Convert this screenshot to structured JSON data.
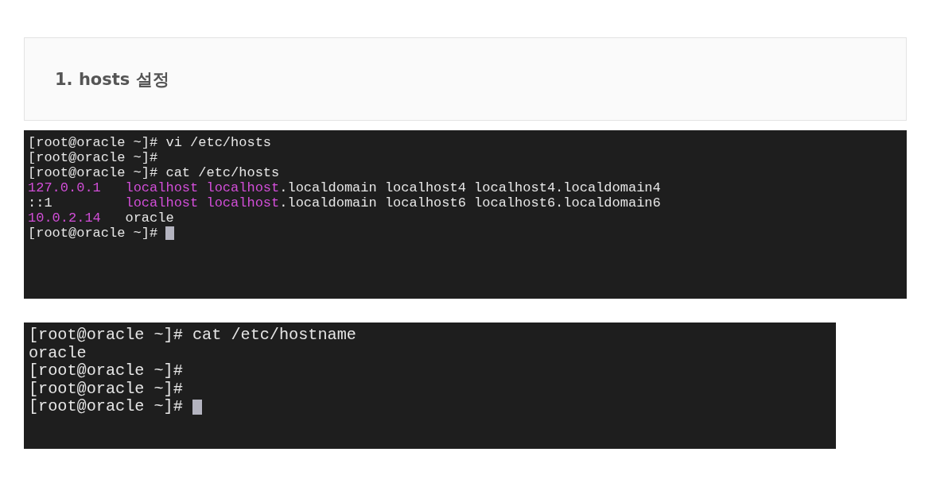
{
  "heading": "1. hosts 설정",
  "terminals": [
    {
      "lines": [
        {
          "segments": [
            {
              "text": "[root@oracle ~]# vi /etc/hosts",
              "kind": "plain"
            }
          ],
          "cursor": false
        },
        {
          "segments": [
            {
              "text": "[root@oracle ~]#",
              "kind": "plain"
            }
          ],
          "cursor": false
        },
        {
          "segments": [
            {
              "text": "[root@oracle ~]# cat /etc/hosts",
              "kind": "plain"
            }
          ],
          "cursor": false
        },
        {
          "segments": [
            {
              "text": "127.0.0.1",
              "kind": "magenta"
            },
            {
              "text": "   localhost localhost",
              "kind": "magenta"
            },
            {
              "text": ".localdomain localhost4 localhost4.localdomain4",
              "kind": "plain"
            }
          ],
          "cursor": false
        },
        {
          "segments": [
            {
              "text": "::1",
              "kind": "plain"
            },
            {
              "text": "         localhost localhost",
              "kind": "magenta"
            },
            {
              "text": ".localdomain localhost6 localhost6.localdomain6",
              "kind": "plain"
            }
          ],
          "cursor": false
        },
        {
          "segments": [
            {
              "text": "10.0.2.14",
              "kind": "magenta"
            },
            {
              "text": "   oracle",
              "kind": "plain"
            }
          ],
          "cursor": false
        },
        {
          "segments": [
            {
              "text": "[root@oracle ~]# ",
              "kind": "plain"
            }
          ],
          "cursor": true
        }
      ]
    },
    {
      "lines": [
        {
          "segments": [
            {
              "text": "[root@oracle ~]# cat /etc/hostname",
              "kind": "plain"
            }
          ],
          "cursor": false
        },
        {
          "segments": [
            {
              "text": "oracle",
              "kind": "plain"
            }
          ],
          "cursor": false
        },
        {
          "segments": [
            {
              "text": "[root@oracle ~]#",
              "kind": "plain"
            }
          ],
          "cursor": false
        },
        {
          "segments": [
            {
              "text": "[root@oracle ~]#",
              "kind": "plain"
            }
          ],
          "cursor": false
        },
        {
          "segments": [
            {
              "text": "[root@oracle ~]# ",
              "kind": "plain"
            }
          ],
          "cursor": true
        }
      ]
    }
  ]
}
